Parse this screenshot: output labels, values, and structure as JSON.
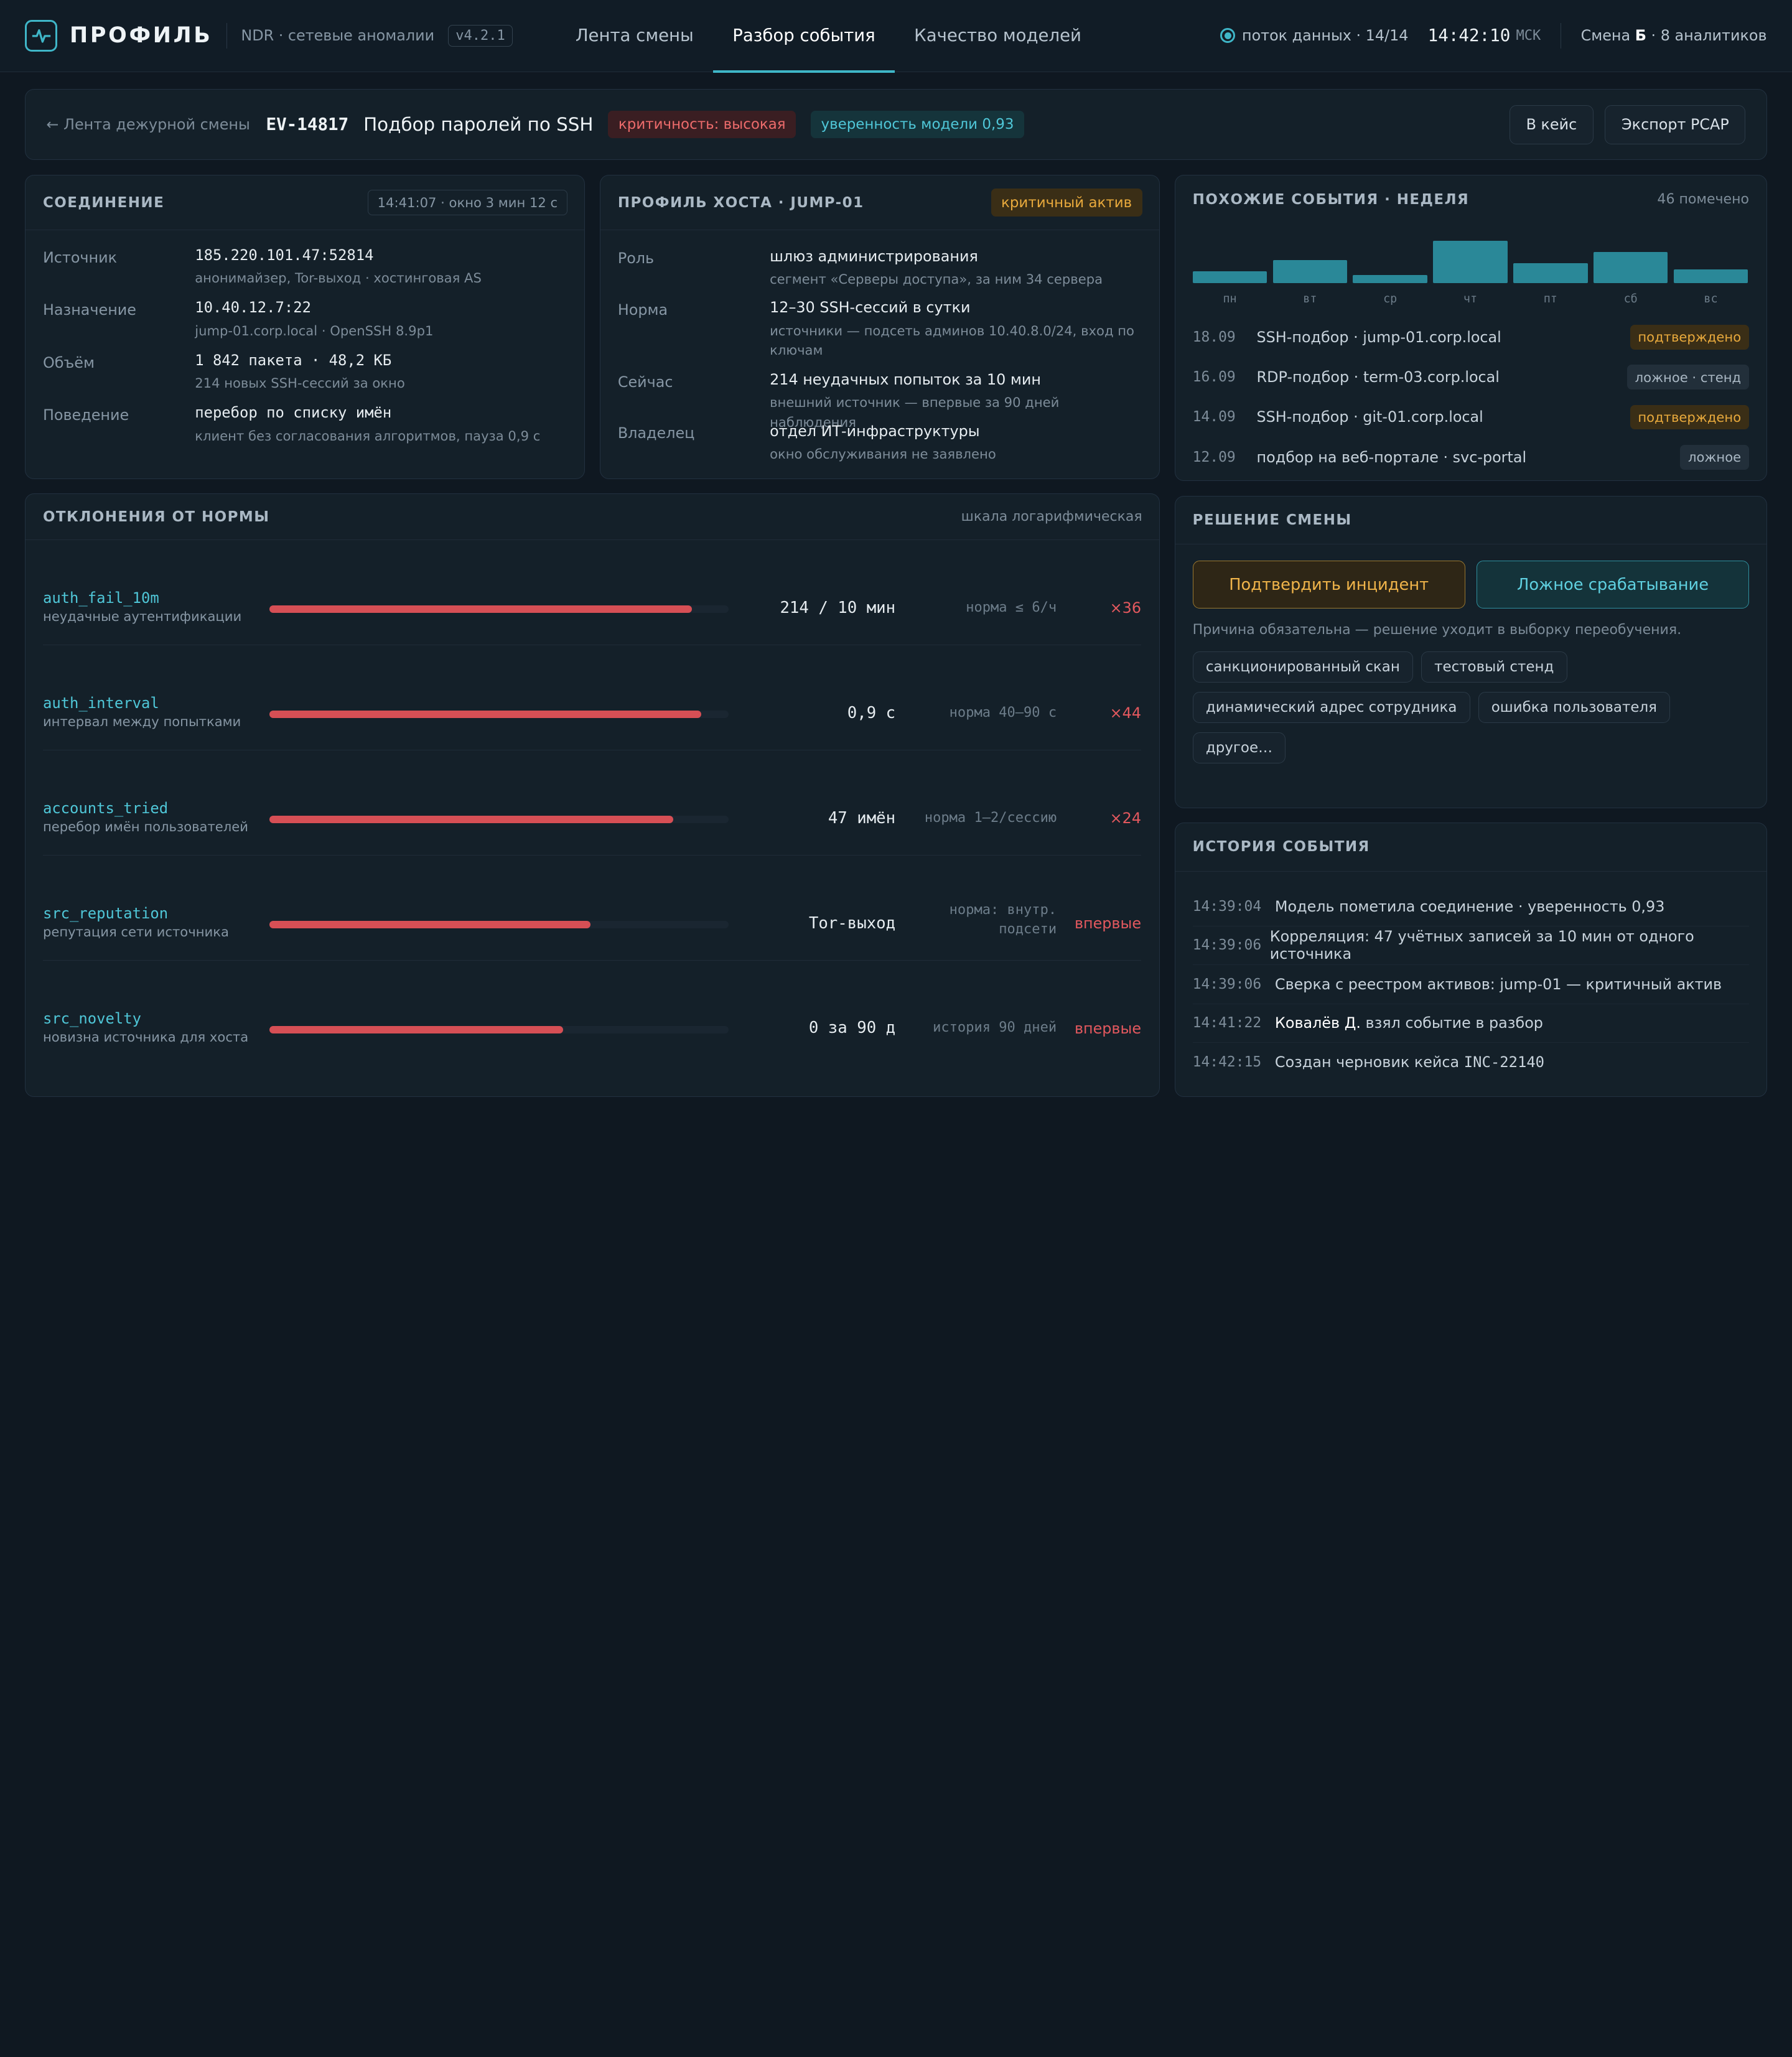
{
  "topbar": {
    "brand": "ПРОФИЛЬ",
    "product": "NDR · сетевые аномалии",
    "version": "v4.2.1",
    "nav": [
      "Лента смены",
      "Разбор события",
      "Качество моделей"
    ],
    "stream": "поток данных · 14/14",
    "clock": "14:42:10",
    "tz": "МСК",
    "shift_prefix": "Смена ",
    "shift_letter": "Б",
    "shift_suffix": " · 8 аналитиков"
  },
  "event": {
    "back": "← Лента дежурной смены",
    "id": "EV-14817",
    "title": "Подбор паролей по SSH",
    "severity": "критичность: высокая",
    "confidence": "уверенность модели 0,93",
    "btn_case": "В кейс",
    "btn_export": "Экспорт PCAP"
  },
  "connection": {
    "title": "Соединение",
    "meta": "14:41:07 · окно 3 мин 12 с",
    "rows": [
      {
        "key": "Источник",
        "main": "185.220.101.47:52814",
        "sub": "анонимайзер, Tor-выход · хостинговая AS"
      },
      {
        "key": "Назначение",
        "main": "10.40.12.7:22",
        "sub": "jump-01.corp.local · OpenSSH 8.9p1"
      },
      {
        "key": "Объём",
        "main": "1 842 пакета · 48,2 КБ",
        "sub": "214 новых SSH-сессий за окно"
      },
      {
        "key": "Поведение",
        "main": "перебор по списку имён",
        "sub": "клиент без согласования алгоритмов, пауза 0,9 с"
      }
    ]
  },
  "host": {
    "title": "Профиль хоста · JUMP-01",
    "badge": "критичный актив",
    "rows": [
      {
        "key": "Роль",
        "main": "шлюз администрирования",
        "sub": "сегмент «Серверы доступа», за ним 34 сервера"
      },
      {
        "key": "Норма",
        "main": "12–30 SSH-сессий в сутки",
        "sub": "источники — подсеть админов 10.40.8.0/24, вход по ключам"
      },
      {
        "key": "Сейчас",
        "main": "214 неудачных попыток за 10 мин",
        "sub": "внешний источник — впервые за 90 дней наблюдения"
      },
      {
        "key": "Владелец",
        "main": "отдел ИТ-инфраструктуры",
        "sub": "окно обслуживания не заявлено"
      }
    ]
  },
  "similar": {
    "title": "Похожие события · неделя",
    "meta": "46 помечено",
    "days": [
      {
        "label": "пн",
        "value": 4
      },
      {
        "label": "вт",
        "value": 8
      },
      {
        "label": "ср",
        "value": 3
      },
      {
        "label": "чт",
        "value": 15
      },
      {
        "label": "пт",
        "value": 7
      },
      {
        "label": "сб",
        "value": 11
      },
      {
        "label": "вс",
        "value": 5
      }
    ],
    "items": [
      {
        "date": "18.09",
        "text": "SSH-подбор · jump-01.corp.local",
        "tag": "подтверждено",
        "kind": "amber"
      },
      {
        "date": "16.09",
        "text": "RDP-подбор · term-03.corp.local",
        "tag": "ложное · стенд",
        "kind": "grey"
      },
      {
        "date": "14.09",
        "text": "SSH-подбор · git-01.corp.local",
        "tag": "подтверждено",
        "kind": "amber"
      },
      {
        "date": "12.09",
        "text": "подбор на веб-портале · svc-portal",
        "tag": "ложное",
        "kind": "grey"
      }
    ]
  },
  "deviations": {
    "title": "Отклонения от нормы",
    "meta": "шкала логарифмическая",
    "rows": [
      {
        "name": "auth_fail_10m",
        "desc": "неудачные аутентификации",
        "level": 0.92,
        "value": "214 / 10 мин",
        "norm": "норма ≤ 6/ч",
        "x": "×36"
      },
      {
        "name": "auth_interval",
        "desc": "интервал между попытками",
        "level": 0.94,
        "value": "0,9 с",
        "norm": "норма 40–90 с",
        "x": "×44"
      },
      {
        "name": "accounts_tried",
        "desc": "перебор имён пользователей",
        "level": 0.88,
        "value": "47 имён",
        "norm": "норма 1–2/сессию",
        "x": "×24"
      },
      {
        "name": "src_reputation",
        "desc": "репутация сети источника",
        "level": 0.7,
        "value": "Tor-выход",
        "norm": "норма: внутр.\nподсети",
        "x": "впервые"
      },
      {
        "name": "src_novelty",
        "desc": "новизна источника для хоста",
        "level": 0.64,
        "value": "0 за 90 д",
        "norm": "история 90 дней",
        "x": "впервые"
      }
    ]
  },
  "decision": {
    "title": "Решение смены",
    "confirm": "Подтвердить инцидент",
    "false_positive": "Ложное срабатывание",
    "hint": "Причина обязательна — решение уходит в выборку переобучения.",
    "reasons": [
      "санкционированный скан",
      "тестовый стенд",
      "динамический адрес сотрудника",
      "ошибка пользователя",
      "другое…"
    ]
  },
  "history": {
    "title": "История события",
    "items": [
      {
        "time": "14:39:04",
        "text": "Модель пометила соединение · уверенность 0,93"
      },
      {
        "time": "14:39:06",
        "text": "Корреляция: 47 учётных записей за 10 мин от одного источника"
      },
      {
        "time": "14:39:06",
        "text": "Сверка с реестром активов: jump-01 — критичный актив"
      },
      {
        "time": "14:41:22",
        "actor": "Ковалёв Д.",
        "text": " взял событие в разбор"
      },
      {
        "time": "14:42:15",
        "text": "Создан черновик кейса ",
        "code": "INC-22140"
      }
    ]
  }
}
